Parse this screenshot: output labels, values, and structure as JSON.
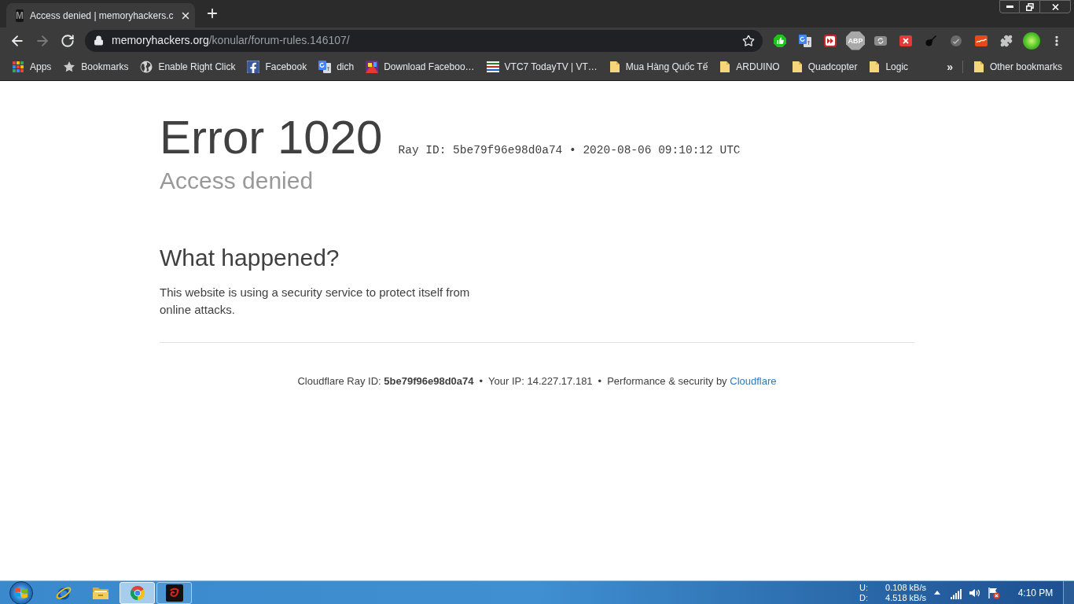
{
  "tabs": [
    {
      "title": "Access denied | memoryhackers.c",
      "favicon": "M",
      "selected": true
    }
  ],
  "toolbar": {
    "nav_buttons": [
      {
        "kind": "back",
        "disabled": false
      },
      {
        "kind": "forward",
        "disabled": true
      },
      {
        "kind": "reload",
        "disabled": false
      }
    ],
    "address_bar": {
      "host": "memoryhackers.org",
      "path": "/konular/forum-rules.146107/",
      "bookmarked": false
    },
    "extensions": [
      {
        "kind": "thumbs-up"
      },
      {
        "kind": "translate"
      },
      {
        "kind": "fast-forward"
      },
      {
        "kind": "abp",
        "text": "ABP"
      },
      {
        "kind": "sync"
      },
      {
        "kind": "x-tile"
      },
      {
        "kind": "guitar"
      },
      {
        "kind": "gauge"
      },
      {
        "kind": "squiggle"
      },
      {
        "kind": "puzzle"
      },
      {
        "kind": "avatar"
      },
      {
        "kind": "menu"
      }
    ]
  },
  "bookmarks_bar": {
    "items": [
      {
        "kind": "apps",
        "label": "Apps"
      },
      {
        "kind": "star",
        "label": "Bookmarks"
      },
      {
        "kind": "globe",
        "label": "Enable Right Click"
      },
      {
        "kind": "facebook",
        "label": "Facebook"
      },
      {
        "kind": "translate",
        "label": "dich"
      },
      {
        "kind": "image",
        "label": "Download Faceboo…"
      },
      {
        "kind": "tv",
        "label": "VTC7 TodayTV | VT…"
      },
      {
        "kind": "folder",
        "label": "Mua Hàng Quốc Tế"
      },
      {
        "kind": "folder",
        "label": "ARDUINO"
      },
      {
        "kind": "folder",
        "label": "Quadcopter"
      },
      {
        "kind": "folder",
        "label": "Logic"
      }
    ],
    "overflow": "»",
    "other": {
      "kind": "folder",
      "label": "Other bookmarks"
    }
  },
  "page": {
    "error_title": "Error 1020",
    "ray_line": "Ray ID: 5be79f96e98d0a74 • 2020-08-06 09:10:12 UTC",
    "subtitle": "Access denied",
    "section_heading": "What happened?",
    "paragraph": "This website is using a security service to protect itself from online attacks.",
    "footer": [
      {
        "kind": "text",
        "text": "Cloudflare Ray ID: **5be79f96e98d0a74**"
      },
      {
        "kind": "separator",
        "text": "•"
      },
      {
        "kind": "text",
        "text": "Your IP: 14.227.17.181"
      },
      {
        "kind": "separator",
        "text": "•"
      },
      {
        "kind": "credit",
        "text": "Performance & security by",
        "link": "Cloudflare"
      }
    ]
  },
  "taskbar": {
    "apps": [
      {
        "kind": "ie",
        "running": false,
        "selected": false
      },
      {
        "kind": "explorer",
        "running": false,
        "selected": false
      },
      {
        "kind": "chrome",
        "running": true,
        "selected": true
      },
      {
        "kind": "garena",
        "running": true,
        "selected": false
      }
    ],
    "network_meter": {
      "upload_label": "U:",
      "upload": "0.108 kB/s",
      "download_label": "D:",
      "download": "4.518 kB/s"
    },
    "tray": [
      {
        "kind": "expand"
      },
      {
        "kind": "signal"
      },
      {
        "kind": "volume"
      },
      {
        "kind": "flag-error"
      }
    ],
    "clock": "4:10 PM"
  }
}
